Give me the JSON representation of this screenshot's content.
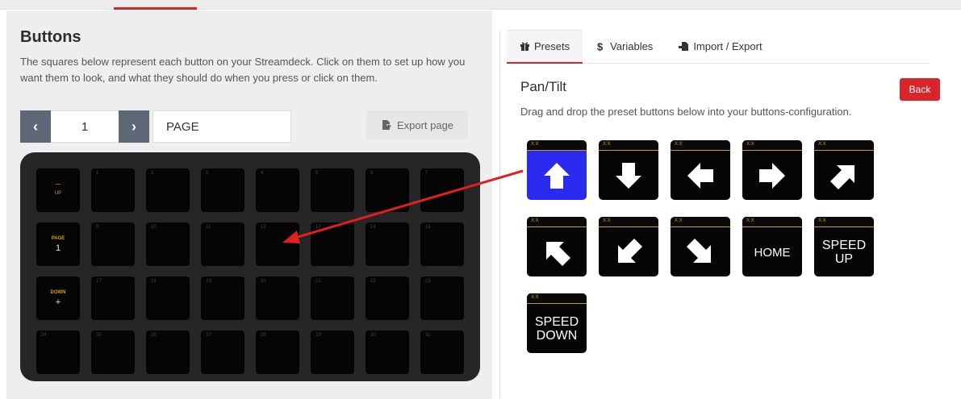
{
  "header": {
    "active_tab_indicator": true
  },
  "buttons_panel": {
    "title": "Buttons",
    "description": "The squares below represent each button on your Streamdeck. Click on them to set up how you want them to look, and what they should do when you press or click on them.",
    "pager": {
      "prev": "‹",
      "page_number": "1",
      "next": "›"
    },
    "page_name": "PAGE",
    "export_label": "Export page"
  },
  "deck": {
    "keys": [
      {
        "num": "",
        "k1": "—",
        "k2": "UP",
        "style": "up"
      },
      {
        "num": "1",
        "k1": "",
        "k2": ""
      },
      {
        "num": "2",
        "k1": "",
        "k2": ""
      },
      {
        "num": "3",
        "k1": "",
        "k2": ""
      },
      {
        "num": "4",
        "k1": "",
        "k2": ""
      },
      {
        "num": "5",
        "k1": "",
        "k2": ""
      },
      {
        "num": "6",
        "k1": "",
        "k2": ""
      },
      {
        "num": "7",
        "k1": "",
        "k2": ""
      },
      {
        "num": "",
        "k1": "PAGE",
        "k2": "1"
      },
      {
        "num": "9",
        "k1": "",
        "k2": ""
      },
      {
        "num": "10",
        "k1": "",
        "k2": ""
      },
      {
        "num": "11",
        "k1": "",
        "k2": ""
      },
      {
        "num": "12",
        "k1": "",
        "k2": ""
      },
      {
        "num": "13",
        "k1": "",
        "k2": ""
      },
      {
        "num": "14",
        "k1": "",
        "k2": ""
      },
      {
        "num": "15",
        "k1": "",
        "k2": ""
      },
      {
        "num": "",
        "k1": "DOWN",
        "k2": "+"
      },
      {
        "num": "17",
        "k1": "",
        "k2": ""
      },
      {
        "num": "18",
        "k1": "",
        "k2": ""
      },
      {
        "num": "19",
        "k1": "",
        "k2": ""
      },
      {
        "num": "20",
        "k1": "",
        "k2": ""
      },
      {
        "num": "21",
        "k1": "",
        "k2": ""
      },
      {
        "num": "22",
        "k1": "",
        "k2": ""
      },
      {
        "num": "23",
        "k1": "",
        "k2": ""
      },
      {
        "num": "24",
        "k1": "",
        "k2": ""
      },
      {
        "num": "25",
        "k1": "",
        "k2": ""
      },
      {
        "num": "26",
        "k1": "",
        "k2": ""
      },
      {
        "num": "27",
        "k1": "",
        "k2": ""
      },
      {
        "num": "28",
        "k1": "",
        "k2": ""
      },
      {
        "num": "29",
        "k1": "",
        "k2": ""
      },
      {
        "num": "30",
        "k1": "",
        "k2": ""
      },
      {
        "num": "31",
        "k1": "",
        "k2": ""
      }
    ]
  },
  "right_panel": {
    "tabs": [
      {
        "label": "Presets",
        "icon": "gift-icon"
      },
      {
        "label": "Variables",
        "icon": "dollar-icon"
      },
      {
        "label": "Import / Export",
        "icon": "file-import-icon"
      }
    ],
    "title": "Pan/Tilt",
    "back_label": "Back",
    "description": "Drag and drop the preset buttons below into your buttons-configuration.",
    "presets": [
      {
        "header": "X:X",
        "type": "icon",
        "icon": "arrow-up-icon",
        "bg": "#2b2bf0"
      },
      {
        "header": "X:X",
        "type": "icon",
        "icon": "arrow-down-icon",
        "bg": "#050505"
      },
      {
        "header": "X:X",
        "type": "icon",
        "icon": "arrow-left-icon",
        "bg": "#050505"
      },
      {
        "header": "X:X",
        "type": "icon",
        "icon": "arrow-right-icon",
        "bg": "#050505"
      },
      {
        "header": "X:X",
        "type": "icon",
        "icon": "arrow-up-right-icon",
        "bg": "#050505"
      },
      {
        "header": "X:X",
        "type": "icon",
        "icon": "arrow-up-left-icon",
        "bg": "#050505"
      },
      {
        "header": "X:X",
        "type": "icon",
        "icon": "arrow-down-left-icon",
        "bg": "#050505"
      },
      {
        "header": "X:X",
        "type": "icon",
        "icon": "arrow-down-right-icon",
        "bg": "#050505"
      },
      {
        "header": "X:X",
        "type": "text",
        "line1": "HOME",
        "line2": "",
        "bg": "#050505"
      },
      {
        "header": "X:X",
        "type": "text",
        "line1": "SPEED",
        "line2": "UP",
        "bg": "#050505"
      },
      {
        "header": "X:X",
        "type": "text",
        "line1": "SPEED",
        "line2": "DOWN",
        "bg": "#050505"
      }
    ]
  },
  "colors": {
    "accent": "#d9252a",
    "deck": "#262626",
    "key": "#050505",
    "gold": "#d6a021",
    "blue_preset": "#2b2bf0",
    "annotation": "#e0201f"
  }
}
